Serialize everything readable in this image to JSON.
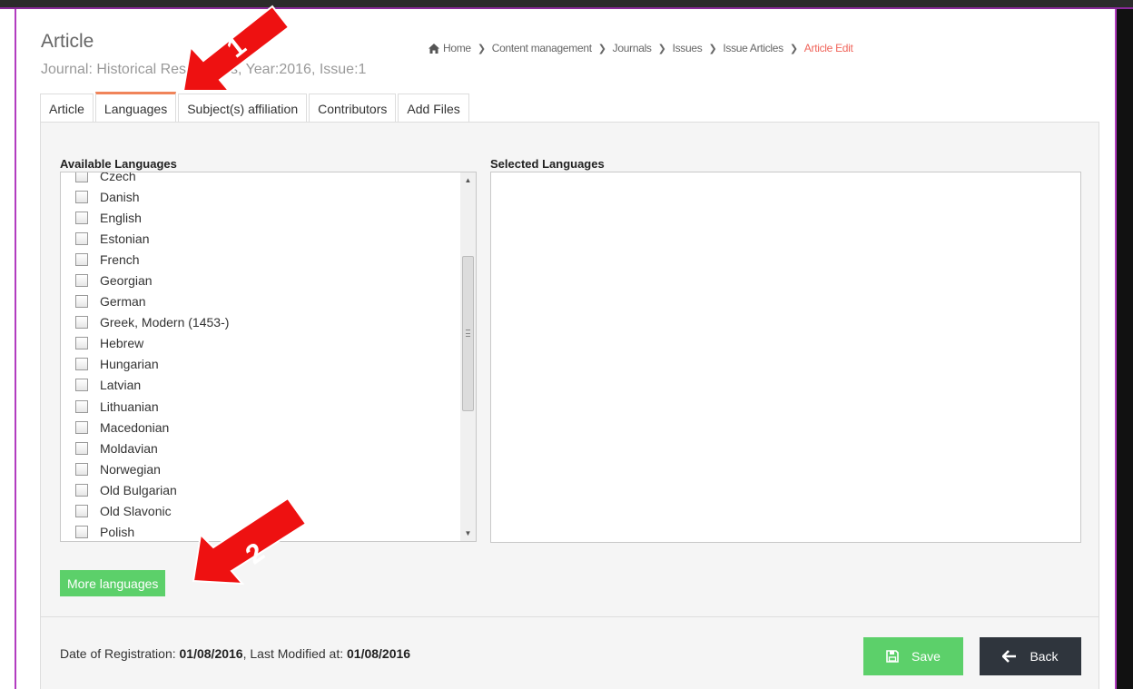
{
  "header": {
    "title": "Article",
    "subtitle": "Journal: Historical Researches, Year:2016, Issue:1"
  },
  "breadcrumb": {
    "items": [
      "Home",
      "Content management",
      "Journals",
      "Issues",
      "Issue Articles",
      "Article Edit"
    ]
  },
  "tabs": [
    "Article",
    "Languages",
    "Subject(s) affiliation",
    "Contributors",
    "Add Files"
  ],
  "languages": {
    "available_label": "Available Languages",
    "selected_label": "Selected Languages",
    "available": [
      "Czech",
      "Danish",
      "English",
      "Estonian",
      "French",
      "Georgian",
      "German",
      "Greek, Modern (1453-)",
      "Hebrew",
      "Hungarian",
      "Latvian",
      "Lithuanian",
      "Macedonian",
      "Moldavian",
      "Norwegian",
      "Old Bulgarian",
      "Old Slavonic",
      "Polish"
    ],
    "selected": [],
    "more_button": "More languages"
  },
  "footer": {
    "registration_label": "Date of Registration: ",
    "registration_date": "01/08/2016",
    "modified_label": ", Last Modified at: ",
    "modified_date": "01/08/2016",
    "save_label": "Save",
    "back_label": "Back"
  },
  "annotations": {
    "arrow1_label": "1",
    "arrow2_label": "2",
    "arrow_color": "#ee1111"
  },
  "colors": {
    "accent_green": "#5cd06a",
    "active_tab_border": "#f0845a",
    "breadcrumb_active": "#f0645a",
    "dark_button": "#2f353d"
  }
}
